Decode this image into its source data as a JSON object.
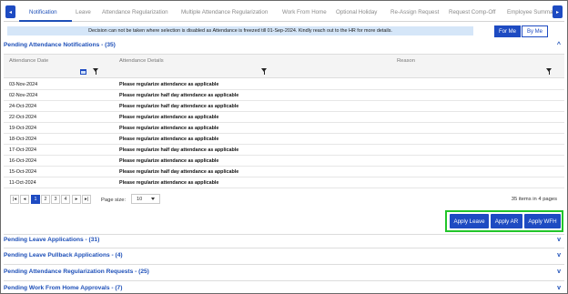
{
  "tabs": {
    "items": [
      {
        "label": "Notification",
        "active": true
      },
      {
        "label": "Leave"
      },
      {
        "label": "Attendance Regularization"
      },
      {
        "label": "Multiple Attendance Regularization"
      },
      {
        "label": "Work From Home"
      },
      {
        "label": "Optional Holiday"
      },
      {
        "label": "Re-Assign Request"
      },
      {
        "label": "Request Comp-Off"
      },
      {
        "label": "Employee Summa"
      }
    ],
    "scroll_left": "◂",
    "scroll_right": "▸"
  },
  "notice": "Decision can not be taken where selection is disabled as Attendance is freezed till 01-Sep-2024. Kindly reach out to the HR for more details.",
  "toggle": {
    "for_me": "For Me",
    "by_me": "By Me"
  },
  "pending_attendance": {
    "title": "Pending Attendance Notifications - (35)",
    "chevron": "^",
    "columns": [
      "Attendance Date",
      "Attendance Details",
      "Reason"
    ],
    "rows": [
      {
        "date": "03-Nov-2024",
        "detail": "Please regularize attendance as applicable"
      },
      {
        "date": "02-Nov-2024",
        "detail": "Please regularize half day attendance as applicable"
      },
      {
        "date": "24-Oct-2024",
        "detail": "Please regularize half day attendance as applicable"
      },
      {
        "date": "22-Oct-2024",
        "detail": "Please regularize attendance as applicable"
      },
      {
        "date": "19-Oct-2024",
        "detail": "Please regularize attendance as applicable"
      },
      {
        "date": "18-Oct-2024",
        "detail": "Please regularize attendance as applicable"
      },
      {
        "date": "17-Oct-2024",
        "detail": "Please regularize half day attendance as applicable"
      },
      {
        "date": "16-Oct-2024",
        "detail": "Please regularize attendance as applicable"
      },
      {
        "date": "15-Oct-2024",
        "detail": "Please regularize half day attendance as applicable"
      },
      {
        "date": "11-Oct-2024",
        "detail": "Please regularize attendance as applicable"
      }
    ],
    "pager": {
      "first": "|◂",
      "prev": "◂",
      "pages": [
        "1",
        "2",
        "3",
        "4"
      ],
      "active_page": "1",
      "next": "▸",
      "last": "▸|",
      "page_size_label": "Page size:",
      "page_size": "10",
      "info": "35 items in 4 pages"
    }
  },
  "actions": {
    "apply_leave": "Apply Leave",
    "apply_ar": "Apply AR",
    "apply_wfh": "Apply WFH"
  },
  "sections": [
    {
      "title": "Pending Leave Applications - (31)",
      "chevron": "v"
    },
    {
      "title": "Pending Leave Pullback Applications - (4)",
      "chevron": "v"
    },
    {
      "title": "Pending Attendance Regularization Requests - (25)",
      "chevron": "v"
    },
    {
      "title": "Pending Work From Home Approvals - (7)",
      "chevron": "v"
    }
  ],
  "colors": {
    "accent": "#1e4bc2",
    "highlight_box": "#22c52a",
    "notice_bg": "#d5e6f8"
  }
}
